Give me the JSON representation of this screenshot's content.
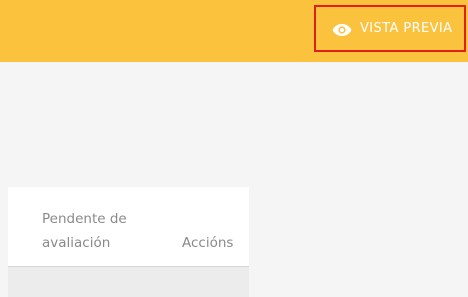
{
  "toolbar": {
    "preview_label": "VISTA PREVIA",
    "preview_icon": "eye-icon",
    "background_color": "#fbc23e",
    "highlight_color": "#e0201c"
  },
  "table": {
    "columns": [
      {
        "label": "Pendente de avaliación"
      },
      {
        "label": "Accións"
      }
    ]
  }
}
